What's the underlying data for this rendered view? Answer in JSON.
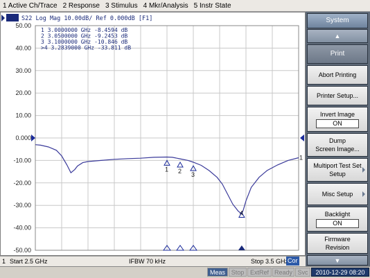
{
  "menu": [
    "1 Active Ch/Trace",
    "2 Response",
    "3 Stimulus",
    "4 Mkr/Analysis",
    "5 Instr State"
  ],
  "trace_header": {
    "badge": "Tr1",
    "text": "S22 Log Mag 10.00dB/ Ref 0.000dB [F1]"
  },
  "chart_data": {
    "type": "line",
    "title": "",
    "xlabel": "",
    "ylabel": "",
    "y_ticks": [
      "50.00",
      "40.00",
      "30.00",
      "20.00",
      "10.00",
      "0.000",
      "-10.00",
      "-20.00",
      "-30.00",
      "-40.00",
      "-50.00"
    ],
    "ylim": [
      -50,
      50
    ],
    "xlim": [
      2.5,
      3.5
    ],
    "grid": true,
    "series": [
      {
        "name": "S22",
        "color": "#3a3a9a",
        "x": [
          2.5,
          2.52,
          2.55,
          2.58,
          2.6,
          2.62,
          2.635,
          2.65,
          2.66,
          2.68,
          2.7,
          2.75,
          2.8,
          2.85,
          2.9,
          2.95,
          3.0,
          3.02,
          3.05,
          3.08,
          3.1,
          3.13,
          3.16,
          3.19,
          3.21,
          3.23,
          3.25,
          3.26,
          3.27,
          3.28,
          3.284,
          3.29,
          3.3,
          3.32,
          3.35,
          3.38,
          3.42,
          3.46,
          3.5
        ],
        "y": [
          -3,
          -3.2,
          -4,
          -5.5,
          -8,
          -12,
          -15.5,
          -14,
          -12.5,
          -11,
          -10.5,
          -10,
          -9.5,
          -9.2,
          -9,
          -8.6,
          -8.5,
          -8.6,
          -9.3,
          -10,
          -10.8,
          -12.2,
          -14.5,
          -17.5,
          -20.5,
          -25,
          -29.5,
          -31,
          -32.5,
          -33.5,
          -33.8,
          -32,
          -28,
          -22,
          -17.5,
          -14.5,
          -12,
          -10,
          -8.8
        ]
      }
    ],
    "markers": [
      {
        "label": "1",
        "x": 3.0,
        "y": -8.4594,
        "text": "1   3.0000000 GHz -8.4594 dB"
      },
      {
        "label": "2",
        "x": 3.05,
        "y": -9.2453,
        "text": "2   3.0500000 GHz -9.2453 dB"
      },
      {
        "label": "3",
        "x": 3.1,
        "y": -10.846,
        "text": "3   3.1000000 GHz -10.846 dB"
      },
      {
        "label": "4",
        "x": 3.2839,
        "y": -33.811,
        "text": ">4  3.2839000 GHz -33.811 dB",
        "active": true
      }
    ],
    "reference_level": "0.000",
    "trace_end_label": "1"
  },
  "status_bar": {
    "channel": "1",
    "start": "Start 2.5 GHz",
    "ifbw": "IFBW 70 kHz",
    "stop": "Stop 3.5 GHz",
    "cor": "Cor"
  },
  "bottom_bar": {
    "meas": "Meas",
    "stop": "Stop",
    "extref": "ExtRef",
    "ready": "Ready",
    "svc": "Svc",
    "datetime": "2010-12-29 08:20"
  },
  "softkeys": {
    "title": "System",
    "print": "Print",
    "abort_printing": "Abort Printing",
    "printer_setup": "Printer Setup...",
    "invert_image": "Invert Image",
    "invert_image_value": "ON",
    "dump_line1": "Dump",
    "dump_line2": "Screen Image...",
    "multiport_line1": "Multiport Test Set",
    "multiport_line2": "Setup",
    "misc_setup": "Misc Setup",
    "backlight": "Backlight",
    "backlight_value": "ON",
    "firmware_line1": "Firmware",
    "firmware_line2": "Revision"
  }
}
